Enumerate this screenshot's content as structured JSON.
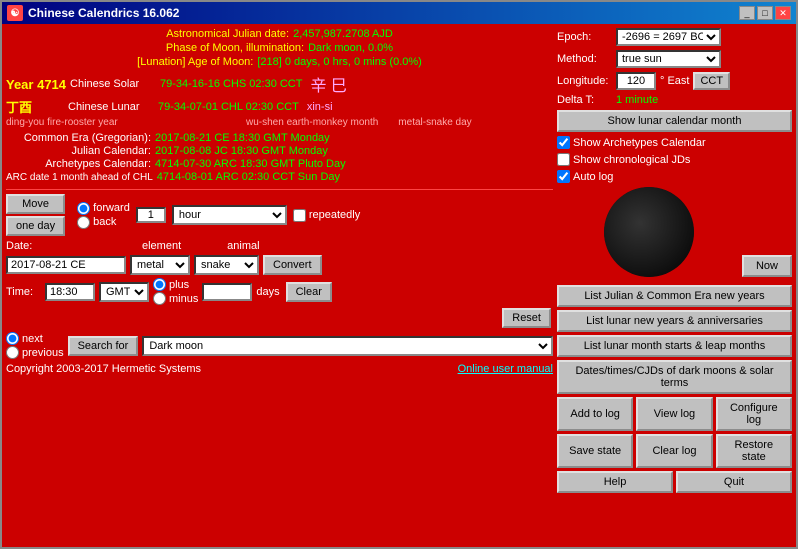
{
  "window": {
    "title": "Chinese Calendrics 16.062",
    "icon": "CC"
  },
  "titleButtons": [
    "_",
    "□",
    "✕"
  ],
  "info": {
    "ajd_label": "Astronomical Julian date:",
    "ajd_value": "2,457,987.2708 AJD",
    "moon_label": "Phase of Moon, illumination:",
    "moon_value": "Dark moon, 0.0%",
    "lunation_label": "[Lunation] Age of Moon:",
    "lunation_value": "[218] 0 days, 0 hrs, 0 mins (0.0%)"
  },
  "year": {
    "year_num": "Year 4714",
    "year_gz": "丁酉",
    "year_sub1": "ding-you fire-rooster year",
    "solar_label": "Chinese Solar",
    "solar_value": "79-34-16-16 CHS 02:30 CCT",
    "solar_extra": "辛 巳",
    "lunar_label": "Chinese Lunar",
    "lunar_value": "79-34-07-01 CHL 02:30 CCT",
    "lunar_extra": "xin-si",
    "year_sub2": "wu-shen earth-monkey month",
    "year_sub3": "metal-snake day"
  },
  "eras": [
    {
      "label": "Common Era (Gregorian):",
      "value": "2017-08-21 CE 18:30 GMT Monday"
    },
    {
      "label": "Julian Calendar:",
      "value": "2017-08-08 JC 18:30 GMT Monday"
    },
    {
      "label": "Archetypes Calendar:",
      "value": "4714-07-30 ARC 18:30 GMT Pluto Day"
    },
    {
      "label": "ARC date 1 month ahead of CHL",
      "value": "4714-08-01 ARC 02:30 CCT Sun Day"
    }
  ],
  "move": {
    "move_btn": "Move",
    "one_day_btn": "one day",
    "forward": "forward",
    "back": "back",
    "spin_val": "1",
    "hour_option": "hour",
    "repeatedly_label": "repeatedly"
  },
  "date": {
    "date_label": "Date:",
    "date_value": "2017-08-21 CE",
    "element_label": "element",
    "element_value": "metal",
    "animal_label": "animal",
    "animal_value": "snake",
    "convert_btn": "Convert",
    "clear_btn": "Clear",
    "reset_btn": "Reset"
  },
  "time": {
    "time_label": "Time:",
    "time_value": "18:30",
    "tz_value": "GMT",
    "plus": "plus",
    "minus": "minus",
    "days_label": "days"
  },
  "search": {
    "search_btn": "Search for",
    "next": "next",
    "previous": "previous",
    "dark_moon": "Dark moon"
  },
  "copyright": {
    "text": "Copyright 2003-2017 Hermetic Systems",
    "manual": "Online user manual"
  },
  "right": {
    "epoch_label": "Epoch:",
    "epoch_value": "-2696 = 2697 BC",
    "method_label": "Method:",
    "method_value": "true sun",
    "lon_label": "Longitude:",
    "lon_value": "120",
    "east_label": "° East",
    "cct_btn": "CCT",
    "delta_label": "Delta T:",
    "delta_value": "1 minute",
    "show_lunar_btn": "Show lunar calendar month",
    "archetypes_check": "Show Archetypes Calendar",
    "chronological_check": "Show chronological JDs",
    "auto_log_check": "Auto log",
    "archetypes_checked": true,
    "chronological_checked": false,
    "auto_log_checked": true
  },
  "actions": {
    "list_julian": "List Julian & Common Era new years",
    "list_lunar_ny": "List lunar new years & anniversaries",
    "list_lunar_month": "List lunar month starts & leap months",
    "dates_dark": "Dates/times/CJDs of dark moons & solar terms",
    "add_log": "Add to log",
    "view_log": "View log",
    "configure_log": "Configure log",
    "save_state": "Save state",
    "clear_log": "Clear log",
    "restore_state": "Restore state",
    "help": "Help",
    "quit": "Quit"
  }
}
